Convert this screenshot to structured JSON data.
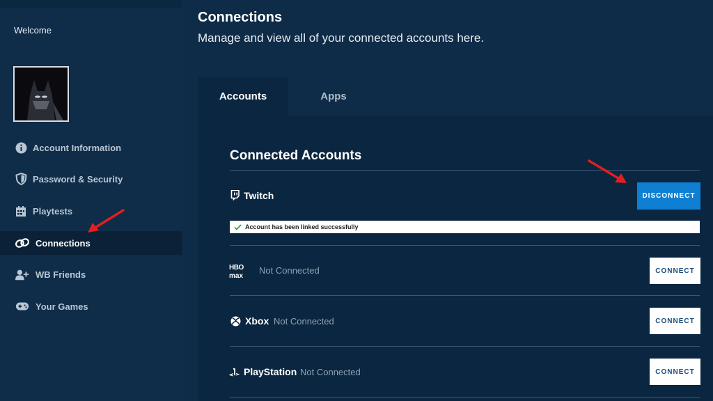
{
  "sidebar": {
    "welcome": "Welcome",
    "items": [
      {
        "label": "Account Information",
        "icon": "info-icon"
      },
      {
        "label": "Password & Security",
        "icon": "shield-icon"
      },
      {
        "label": "Playtests",
        "icon": "calendar-icon"
      },
      {
        "label": "Connections",
        "icon": "link-icon",
        "active": true
      },
      {
        "label": "WB Friends",
        "icon": "add-friend-icon"
      },
      {
        "label": "Your Games",
        "icon": "gamepad-icon"
      }
    ]
  },
  "header": {
    "title": "Connections",
    "subtitle": "Manage and view all of your connected accounts here."
  },
  "tabs": [
    {
      "label": "Accounts",
      "active": true
    },
    {
      "label": "Apps",
      "active": false
    }
  ],
  "connected": {
    "title": "Connected Accounts",
    "accounts": [
      {
        "name": "Twitch",
        "status": "",
        "button": "DISCONNECT",
        "icon": "twitch-icon"
      },
      {
        "name": "",
        "status": "Not Connected",
        "button": "CONNECT",
        "icon": "hbo-max-logo"
      },
      {
        "name": "Xbox",
        "status": "Not Connected",
        "button": "CONNECT",
        "icon": "xbox-icon"
      },
      {
        "name": "PlayStation",
        "status": "Not Connected",
        "button": "CONNECT",
        "icon": "playstation-icon"
      }
    ],
    "success_message": "Account has been linked successfully"
  },
  "colors": {
    "background": "#0e2b47",
    "panel": "#0b2640",
    "accent_button": "#0f7fd3",
    "annotation_arrow": "#e02020",
    "success_check": "#2fa84f"
  }
}
